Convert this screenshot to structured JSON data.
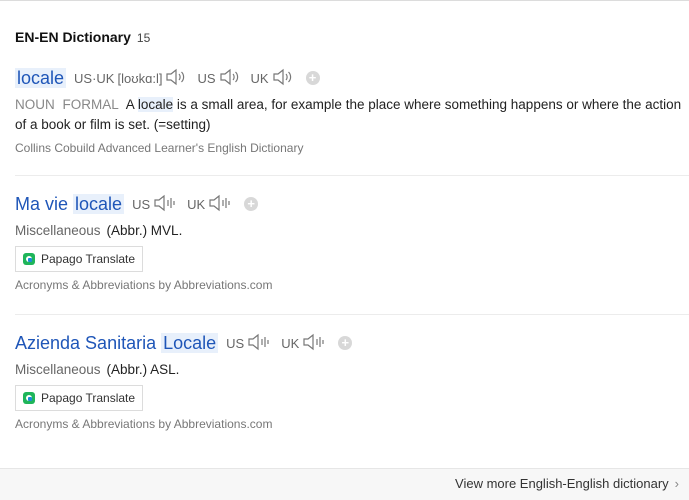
{
  "header": {
    "title": "EN-EN Dictionary",
    "count": "15"
  },
  "entries": [
    {
      "word_pre": "",
      "word_hl": "locale",
      "pron_us_uk_label": "US·UK",
      "pron_ipa": "[loʊkɑ:l]",
      "pron_us_label": "US",
      "pron_uk_label": "UK",
      "pos": "NOUN",
      "register": "FORMAL",
      "def_pre": "A",
      "def_hl": "locale",
      "def_post": "is a small area, for example the place where something happens or where the action of a book or film is set. (=setting)",
      "source": "Collins Cobuild Advanced Learner's English Dictionary"
    },
    {
      "word_pre": "Ma vie",
      "word_hl": "locale",
      "pron_us_label": "US",
      "pron_uk_label": "UK",
      "category": "Miscellaneous",
      "abbr": "(Abbr.) MVL.",
      "translate_label": "Papago Translate",
      "source": "Acronyms & Abbreviations by Abbreviations.com"
    },
    {
      "word_pre": "Azienda Sanitaria",
      "word_hl": "Locale",
      "pron_us_label": "US",
      "pron_uk_label": "UK",
      "category": "Miscellaneous",
      "abbr": "(Abbr.) ASL.",
      "translate_label": "Papago Translate",
      "source": "Acronyms & Abbreviations by Abbreviations.com"
    }
  ],
  "footer": {
    "more_label": "View more English-English dictionary"
  },
  "icons": {
    "speaker": "speaker-icon",
    "add": "plus-circle-icon",
    "papago": "papago-icon",
    "chevron": "chevron-right-icon"
  },
  "colors": {
    "link": "#1f56b8",
    "highlight": "#e8f0fb",
    "papago_green": "#1fb55a"
  }
}
